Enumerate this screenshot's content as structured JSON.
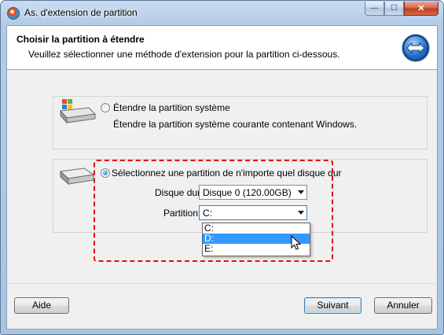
{
  "window": {
    "title": "As. d'extension de partition",
    "caption_buttons": {
      "minimize": "—",
      "maximize": "☐",
      "close": "✕"
    }
  },
  "header": {
    "title": "Choisir la partition à étendre",
    "subtitle": "Veuillez sélectionner une méthode d'extension pour la partition ci-dessous.",
    "icon": "extend-arrows-icon"
  },
  "option_system": {
    "label": "Étendre la partition système",
    "description": "Étendre la partition système courante contenant Windows.",
    "selected": false,
    "icon": "windows-drive-icon"
  },
  "option_any": {
    "label": "Sélectionnez une partition de n'importe quel disque dur",
    "selected": true,
    "icon": "hard-drive-icon",
    "disk_label": "Disque dur",
    "disk_value": "Disque 0 (120.00GB)",
    "partition_label": "Partition",
    "partition_value": "C:",
    "partition_options": [
      "C:",
      "D:",
      "E:"
    ],
    "hovered_option": "D:"
  },
  "footer": {
    "help_label": "Aide",
    "next_label": "Suivant",
    "cancel_label": "Annuler"
  },
  "colors": {
    "highlight": "#e01010",
    "selection": "#3399ff"
  }
}
